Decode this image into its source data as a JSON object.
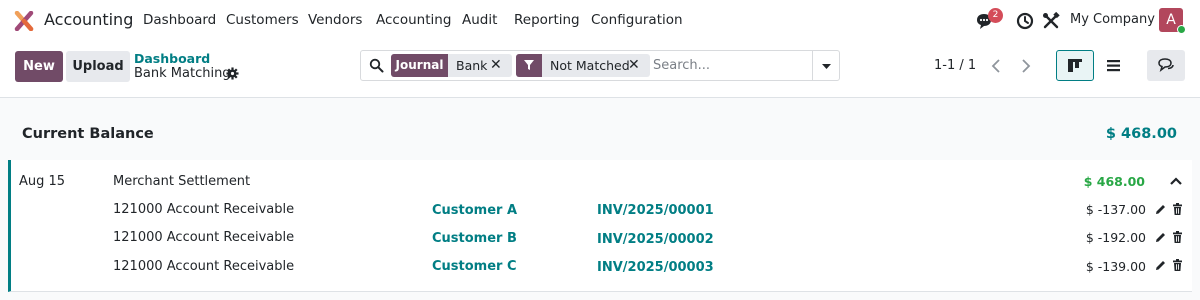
{
  "navbar": {
    "app_name": "Accounting",
    "menu": [
      "Dashboard",
      "Customers",
      "Vendors",
      "Accounting",
      "Audit",
      "Reporting",
      "Configuration"
    ],
    "messages_badge": "2",
    "company": "My Company",
    "avatar_initial": "A"
  },
  "control_panel": {
    "new_label": "New",
    "upload_label": "Upload",
    "breadcrumb_parent": "Dashboard",
    "breadcrumb_current": "Bank Matching",
    "search": {
      "facets": [
        {
          "key": "Journal",
          "value": "Bank"
        },
        {
          "key": "filter-icon",
          "value": "Not Matched"
        }
      ],
      "placeholder": "Search..."
    },
    "pager": "1-1 / 1"
  },
  "content": {
    "balance_label": "Current Balance",
    "balance_amount": "$ 468.00",
    "statement": {
      "date": "Aug 15",
      "label": "Merchant Settlement",
      "amount": "$ 468.00",
      "lines": [
        {
          "account": "121000 Account Receivable",
          "partner": "Customer A",
          "reference": "INV/2025/00001",
          "amount": "$ -137.00"
        },
        {
          "account": "121000 Account Receivable",
          "partner": "Customer B",
          "reference": "INV/2025/00002",
          "amount": "$ -192.00"
        },
        {
          "account": "121000 Account Receivable",
          "partner": "Customer C",
          "reference": "INV/2025/00003",
          "amount": "$ -139.00"
        }
      ]
    }
  },
  "colors": {
    "brand": "#714b67",
    "accent": "#017e84",
    "positive": "#28a745",
    "badge": "#d44c59"
  }
}
